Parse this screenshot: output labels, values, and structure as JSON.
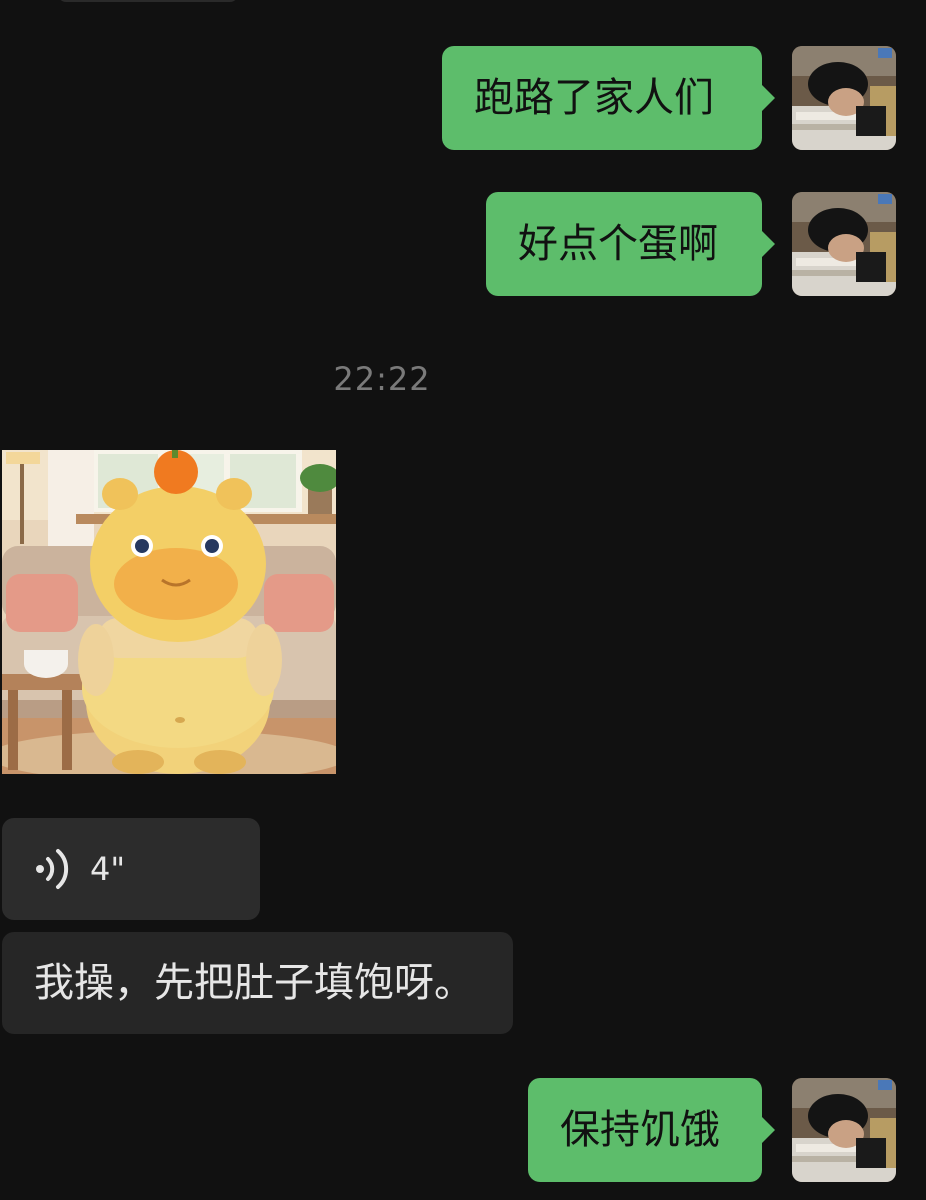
{
  "messages": {
    "out1": {
      "text": "跑路了家人们"
    },
    "out2": {
      "text": "好点个蛋啊"
    },
    "timestamp": "22:22",
    "voice": {
      "duration": "4\""
    },
    "in_text": {
      "text": "我操，先把肚子填饱呀。"
    },
    "out3": {
      "text": "保持饥饿"
    }
  },
  "colors": {
    "background": "#111111",
    "outgoing_bubble": "#5dbd6b",
    "incoming_bubble": "#2c2c2c",
    "timestamp": "#7a7a7a"
  },
  "icons": {
    "voice": "voice-wave-icon"
  }
}
